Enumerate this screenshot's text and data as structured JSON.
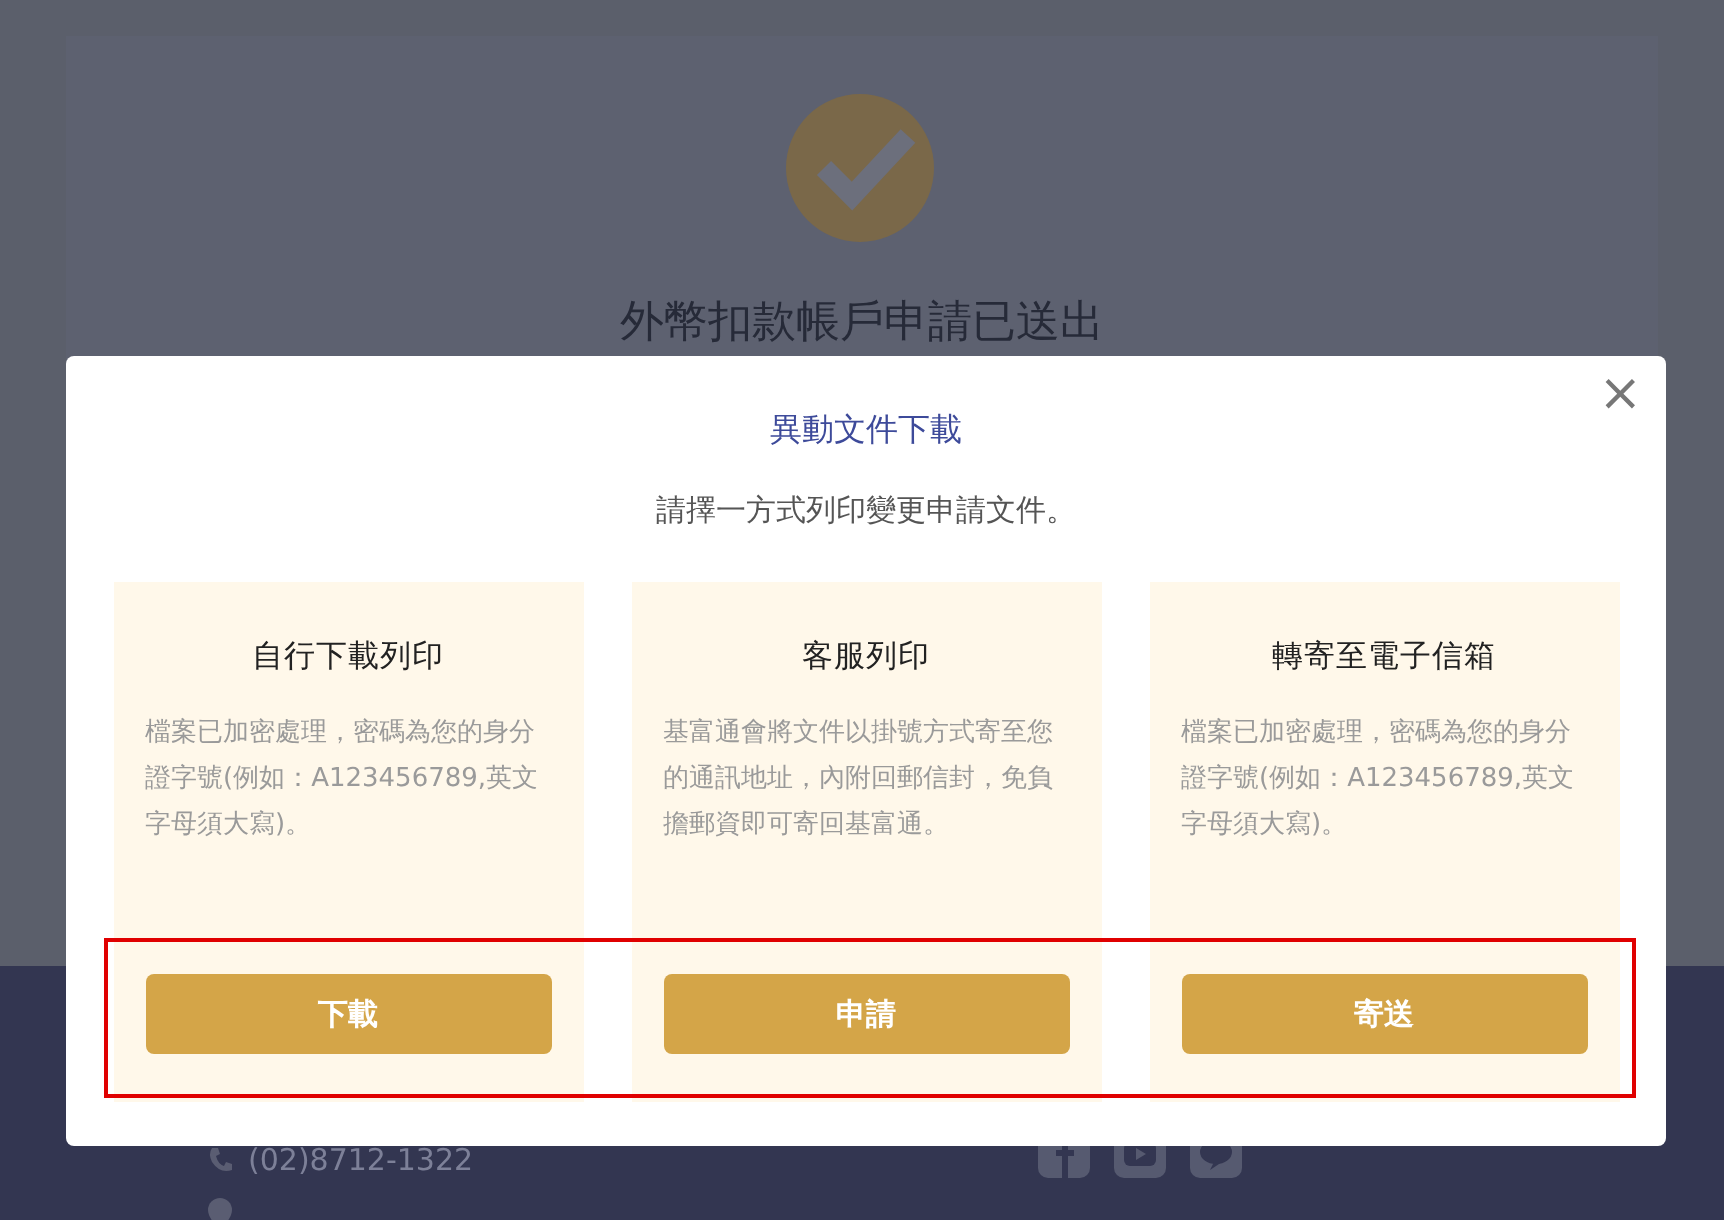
{
  "background_page": {
    "heading": "外幣扣款帳戶申請已送出",
    "footer": {
      "phone": "(02)8712-1322"
    }
  },
  "modal": {
    "title": "異動文件下載",
    "subtitle": "請擇一方式列印變更申請文件。",
    "close": "×",
    "options": [
      {
        "title": "自行下載列印",
        "description": "檔案已加密處理，密碼為您的身分證字號(例如：A123456789,英文字母須大寫)。",
        "button": "下載"
      },
      {
        "title": "客服列印",
        "description": "基富通會將文件以掛號方式寄至您的通訊地址，內附回郵信封，免負擔郵資即可寄回基富通。",
        "button": "申請"
      },
      {
        "title": "轉寄至電子信箱",
        "description": "檔案已加密處理，密碼為您的身分證字號(例如：A123456789,英文字母須大寫)。",
        "button": "寄送"
      }
    ]
  },
  "annotation": {
    "kind": "highlight",
    "color": "#e00000"
  }
}
